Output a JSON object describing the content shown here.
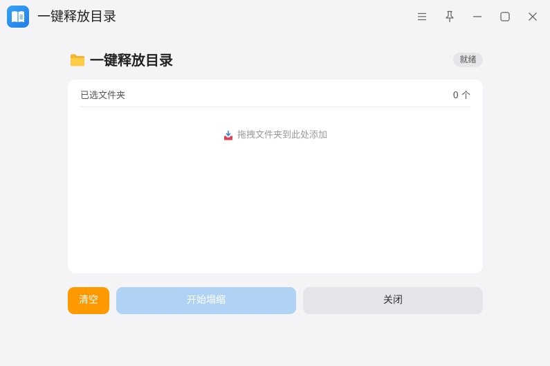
{
  "window": {
    "title": "一键释放目录",
    "app_icon": "book-icon",
    "controls": [
      "menu-icon",
      "pin-icon",
      "minimize-icon",
      "maximize-icon",
      "close-icon"
    ]
  },
  "header": {
    "icon": "folder-icon",
    "title": "一键释放目录",
    "status": "就绪"
  },
  "panel": {
    "label": "已选文件夹",
    "count": "0 个",
    "hint_icon": "inbox-tray-icon",
    "empty_hint": "拖拽文件夹到此处添加"
  },
  "actions": {
    "clear": "清空",
    "start": "开始塌缩",
    "close": "关闭"
  },
  "colors": {
    "accent_orange": "#ff9900",
    "start_disabled": "#b0d3f5",
    "app_icon_blue": "#1f7fe6",
    "background": "#f4f4f7"
  }
}
